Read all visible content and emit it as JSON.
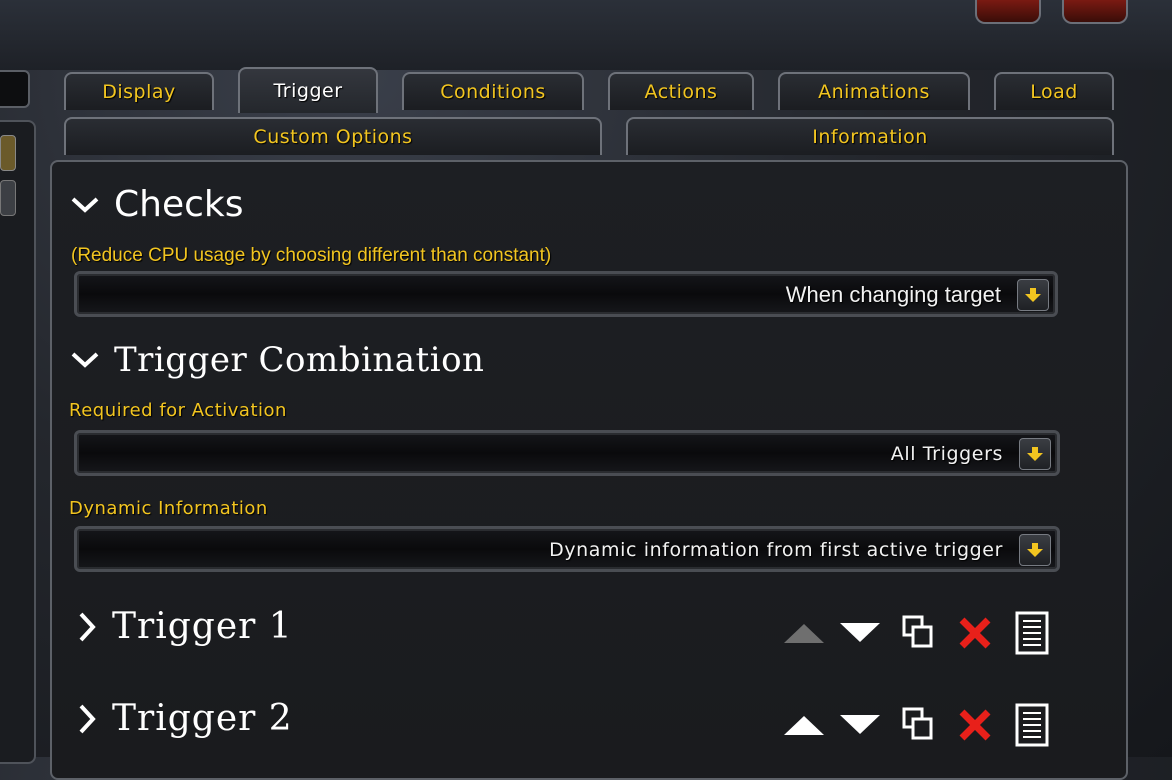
{
  "tabs_row1": [
    "Display",
    "Trigger",
    "Conditions",
    "Actions",
    "Animations",
    "Load"
  ],
  "tabs_row2": [
    "Custom Options",
    "Information"
  ],
  "selected_tab": "Trigger",
  "checks": {
    "title": "Checks",
    "hint": "(Reduce CPU usage by choosing different than constant)",
    "value": "When changing target"
  },
  "combination": {
    "title": "Trigger Combination",
    "required_label": "Required for Activation",
    "required_value": "All Triggers",
    "dynamic_label": "Dynamic Information",
    "dynamic_value": "Dynamic information from first active trigger"
  },
  "triggers": [
    {
      "title": "Trigger 1",
      "up_enabled": false
    },
    {
      "title": "Trigger 2",
      "up_enabled": true
    }
  ],
  "icons": {
    "collapse": "chevron-down-icon",
    "expand": "chevron-right-icon",
    "dropdown": "dropdown-arrow-icon",
    "move_up": "arrow-up-icon",
    "move_down": "arrow-down-icon",
    "duplicate": "duplicate-icon",
    "delete": "delete-icon",
    "notes": "notes-icon"
  },
  "colors": {
    "gold": "#f2c520",
    "delete_red": "#e8201a",
    "disabled_gray": "#777777"
  }
}
